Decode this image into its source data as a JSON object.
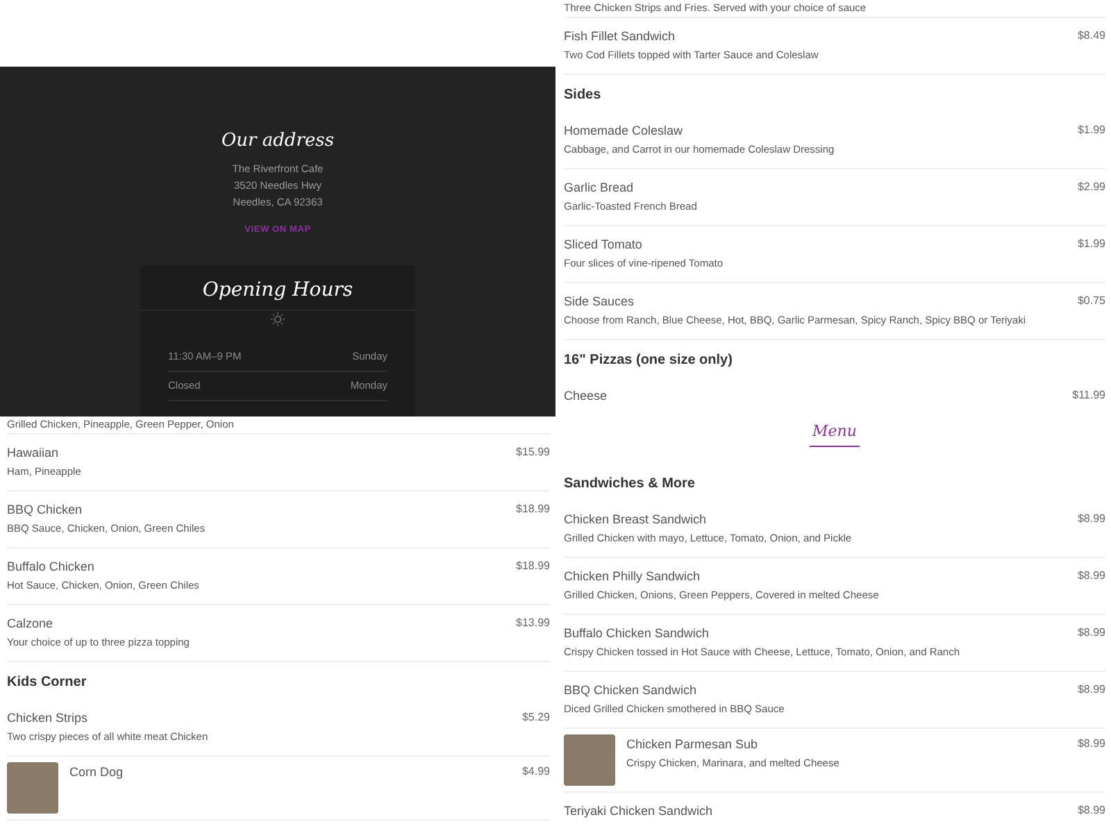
{
  "address_panel": {
    "title": "Our address",
    "lines": [
      "The Riverfront Cafe",
      "3520 Needles Hwy",
      "Needles, CA 92363"
    ],
    "map_link": "VIEW ON MAP",
    "hours": {
      "title": "Opening Hours",
      "rows": [
        {
          "time": "11:30 AM–9 PM",
          "day": "Sunday"
        },
        {
          "time": "Closed",
          "day": "Monday"
        }
      ]
    }
  },
  "menu_panels": [
    {
      "blocks": [
        {
          "kind": "note",
          "text": "Three Chicken Strips and Fries. Served with your choice of sauce"
        },
        {
          "kind": "item",
          "name": "Fish Fillet Sandwich",
          "description": "Two Cod Fillets topped with Tarter Sauce and Coleslaw",
          "price": "$8.49"
        },
        {
          "kind": "heading",
          "text": "Sides"
        },
        {
          "kind": "item",
          "name": "Homemade Coleslaw",
          "description": "Cabbage, and Carrot in our homemade Coleslaw Dressing",
          "price": "$1.99"
        },
        {
          "kind": "item",
          "name": "Garlic Bread",
          "description": "Garlic-Toasted French Bread",
          "price": "$2.99"
        },
        {
          "kind": "item",
          "name": "Sliced Tomato",
          "description": "Four slices of vine-ripened Tomato",
          "price": "$1.99"
        },
        {
          "kind": "item",
          "name": "Side Sauces",
          "description": "Choose from Ranch, Blue Cheese, Hot, BBQ, Garlic Parmesan, Spicy Ranch, Spicy BBQ or Teriyaki",
          "price": "$0.75"
        },
        {
          "kind": "heading",
          "text": "16\" Pizzas (one size only)"
        },
        {
          "kind": "item",
          "name": "Cheese",
          "price": "$11.99"
        }
      ]
    },
    {
      "blocks": [
        {
          "kind": "note",
          "text": "Grilled Chicken, Pineapple, Green Pepper, Onion"
        },
        {
          "kind": "item",
          "name": "Hawaiian",
          "description": "Ham, Pineapple",
          "price": "$15.99"
        },
        {
          "kind": "item",
          "name": "BBQ Chicken",
          "description": "BBQ Sauce, Chicken, Onion, Green Chiles",
          "price": "$18.99"
        },
        {
          "kind": "item",
          "name": "Buffalo Chicken",
          "description": "Hot Sauce, Chicken, Onion, Green Chiles",
          "price": "$18.99"
        },
        {
          "kind": "item",
          "name": "Calzone",
          "description": "Your choice of up to three pizza topping",
          "price": "$13.99"
        },
        {
          "kind": "heading",
          "text": "Kids Corner"
        },
        {
          "kind": "item",
          "name": "Chicken Strips",
          "description": "Two crispy pieces of all white meat Chicken",
          "price": "$5.29"
        },
        {
          "kind": "photo_item",
          "name": "Corn Dog",
          "price": "$4.99"
        }
      ]
    },
    {
      "blocks": [
        {
          "kind": "title",
          "text": "Menu"
        },
        {
          "kind": "heading",
          "text": "Sandwiches & More"
        },
        {
          "kind": "item",
          "name": "Chicken Breast Sandwich",
          "description": "Grilled Chicken with mayo, Lettuce, Tomato, Onion, and Pickle",
          "price": "$8.99"
        },
        {
          "kind": "item",
          "name": "Chicken Philly Sandwich",
          "description": "Grilled Chicken, Onions, Green Peppers, Covered in melted Cheese",
          "price": "$8.99"
        },
        {
          "kind": "item",
          "name": "Buffalo Chicken Sandwich",
          "description": "Crispy Chicken tossed in Hot Sauce with Cheese, Lettuce, Tomato, Onion, and Ranch",
          "price": "$8.99"
        },
        {
          "kind": "item",
          "name": "BBQ Chicken Sandwich",
          "description": "Diced Grilled Chicken smothered in BBQ Sauce",
          "price": "$8.99"
        },
        {
          "kind": "photo_item",
          "name": "Chicken Parmesan Sub",
          "description": "Crispy Chicken, Marinara, and melted Cheese",
          "price": "$8.99"
        },
        {
          "kind": "item",
          "name": "Teriyaki Chicken Sandwich",
          "price": "$8.99"
        }
      ]
    }
  ]
}
